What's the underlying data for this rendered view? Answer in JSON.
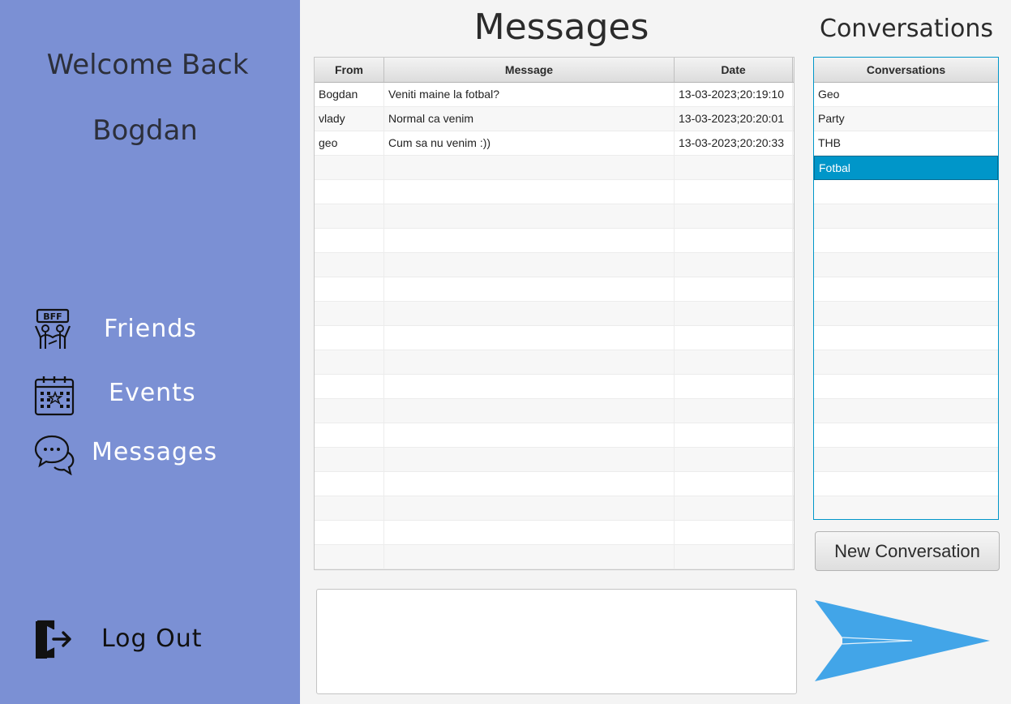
{
  "sidebar": {
    "welcome": "Welcome Back",
    "username": "Bogdan",
    "items": [
      {
        "label": "Friends",
        "icon": "bff-friends-icon"
      },
      {
        "label": "Events",
        "icon": "calendar-icon"
      },
      {
        "label": "Messages",
        "icon": "chat-bubbles-icon"
      }
    ],
    "logout": {
      "label": "Log Out",
      "icon": "logout-door-icon"
    },
    "bg_color": "#7b90d4"
  },
  "main": {
    "title": "Messages",
    "table": {
      "columns": [
        "From",
        "Message",
        "Date"
      ],
      "rows": [
        {
          "from": "Bogdan",
          "message": "Veniti maine la fotbal?",
          "date": "13-03-2023;20:19:10"
        },
        {
          "from": "vlady",
          "message": "Normal ca venim",
          "date": "13-03-2023;20:20:01"
        },
        {
          "from": "geo",
          "message": "Cum sa nu venim :))",
          "date": "13-03-2023;20:20:33"
        }
      ]
    },
    "input": {
      "value": "",
      "placeholder": ""
    },
    "send": {
      "icon": "send-arrow-icon",
      "color": "#42a5e8"
    }
  },
  "conversations": {
    "title": "Conversations",
    "header": "Conversations",
    "items": [
      "Geo",
      "Party",
      "THB",
      "Fotbal"
    ],
    "selected": "Fotbal",
    "selected_color": "#0096c9",
    "new_button": "New Conversation"
  }
}
